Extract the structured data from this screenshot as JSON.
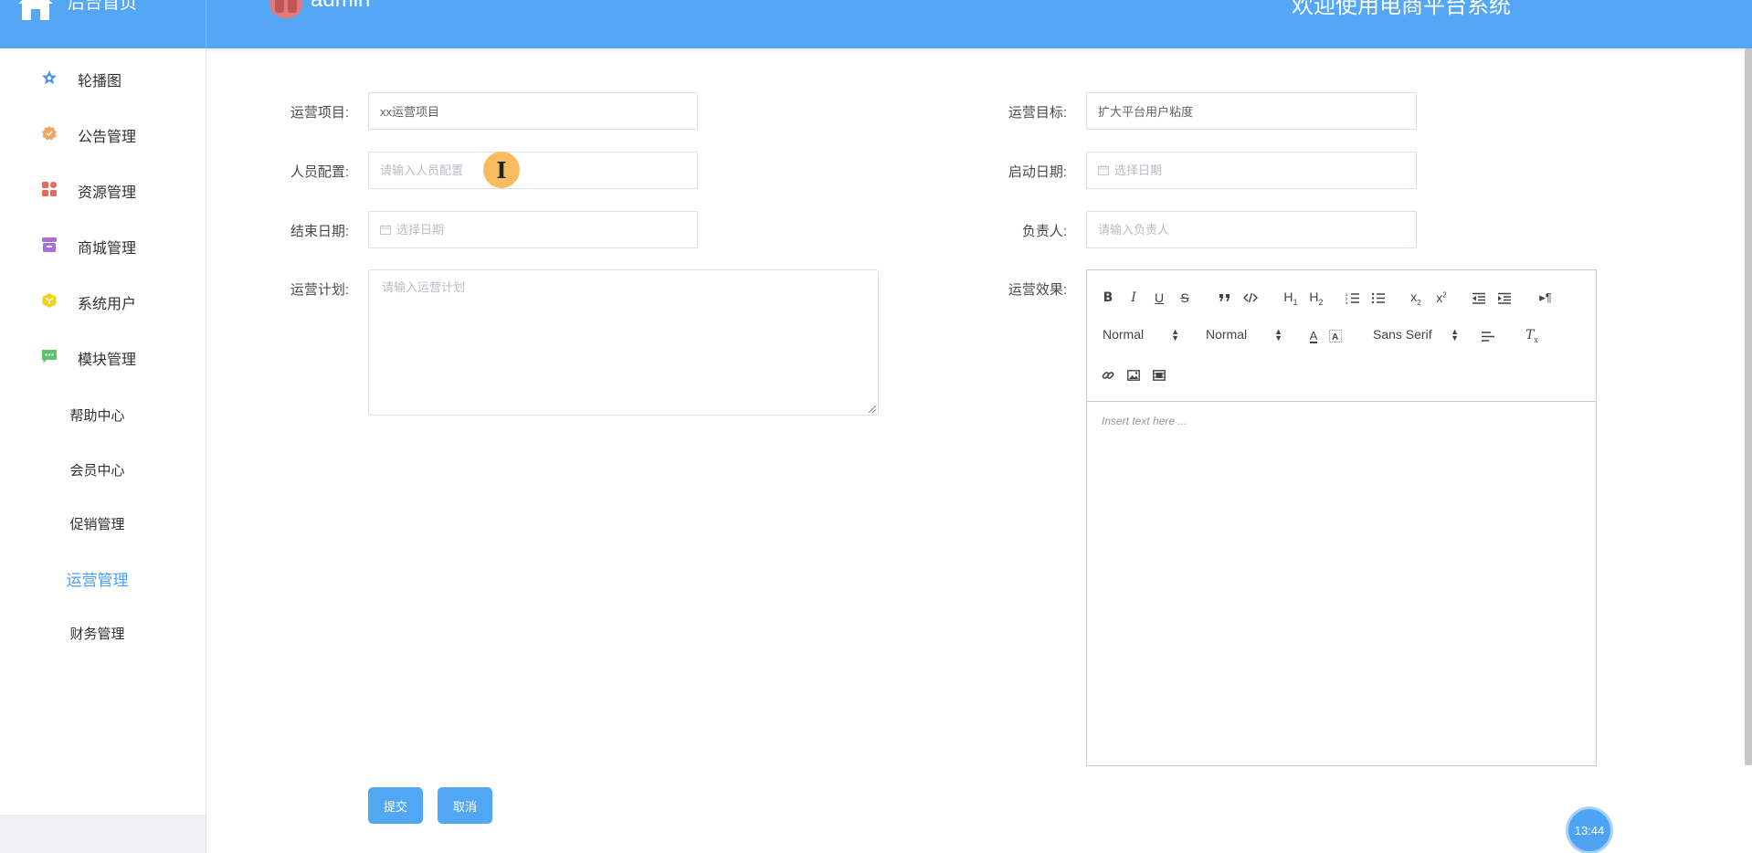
{
  "header": {
    "home_label": "后台首页",
    "username": "admin",
    "welcome": "欢迎使用电商平台系统"
  },
  "sidebar": {
    "items": [
      {
        "label": "轮播图",
        "icon": "star-icon",
        "color": "#4d8ff0"
      },
      {
        "label": "公告管理",
        "icon": "badge-icon",
        "color": "#f5a35c"
      },
      {
        "label": "资源管理",
        "icon": "grid-icon",
        "color": "#e86a5a"
      },
      {
        "label": "商城管理",
        "icon": "archive-icon",
        "color": "#a86fd6"
      },
      {
        "label": "系统用户",
        "icon": "cube-icon",
        "color": "#f2d21b"
      },
      {
        "label": "模块管理",
        "icon": "message-icon",
        "color": "#5cc46a"
      }
    ],
    "sub_items": [
      {
        "label": "帮助中心"
      },
      {
        "label": "会员中心"
      },
      {
        "label": "促销管理"
      },
      {
        "label": "运营管理",
        "active": true
      },
      {
        "label": "财务管理"
      }
    ]
  },
  "form": {
    "project": {
      "label": "运营项目:",
      "value": "xx运营项目"
    },
    "goal": {
      "label": "运营目标:",
      "value": "扩大平台用户粘度"
    },
    "staff": {
      "label": "人员配置:",
      "placeholder": "请输入人员配置"
    },
    "start_date": {
      "label": "启动日期:",
      "placeholder": "选择日期"
    },
    "end_date": {
      "label": "结束日期:",
      "placeholder": "选择日期"
    },
    "owner": {
      "label": "负责人:",
      "placeholder": "请输入负责人"
    },
    "plan": {
      "label": "运营计划:",
      "placeholder": "请输入运营计划"
    },
    "effect": {
      "label": "运营效果:"
    }
  },
  "editor": {
    "header_select": "Normal",
    "size_select": "Normal",
    "font_select": "Sans Serif",
    "placeholder": "Insert text here ..."
  },
  "buttons": {
    "submit": "提交",
    "cancel": "取消"
  },
  "clock": "13:44",
  "colors": {
    "header_bg": "#55a6f5",
    "primary": "#52a7f5",
    "active_menu": "#4d9ff0"
  }
}
